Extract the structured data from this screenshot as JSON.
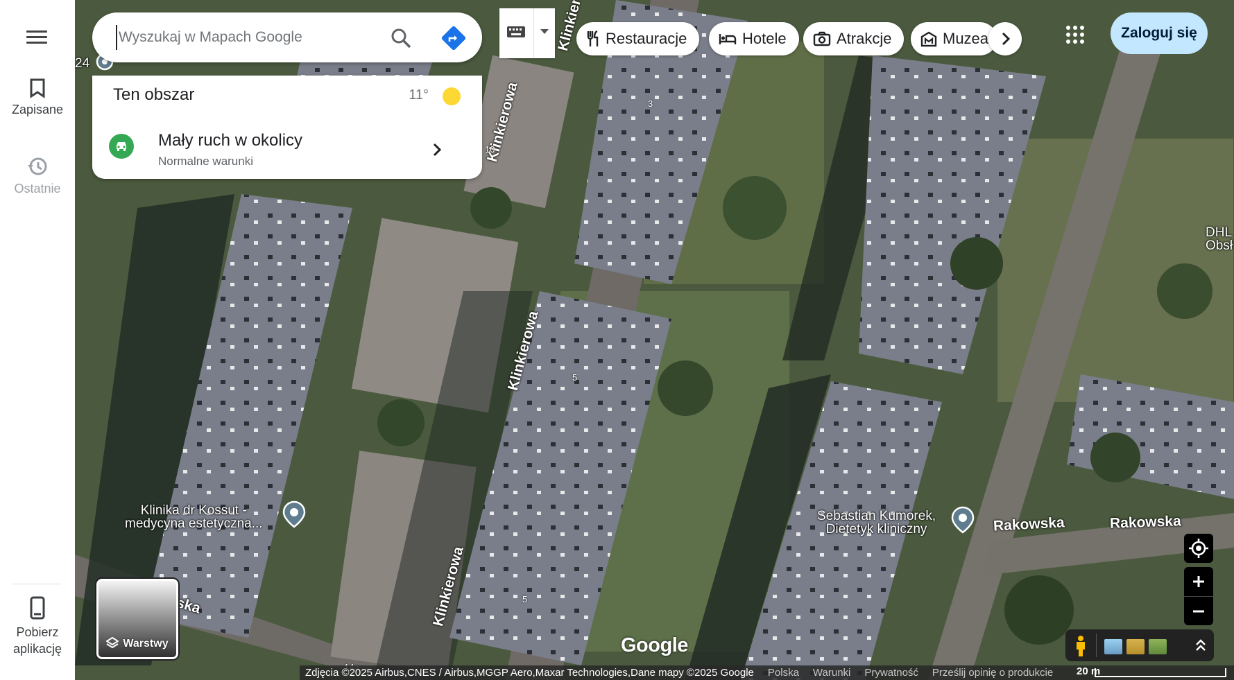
{
  "rail": {
    "menu_icon": "menu-icon",
    "saved_label": "Zapisane",
    "saved_icon": "bookmark-icon",
    "recent_label": "Ostatnie",
    "recent_icon": "history-icon",
    "get_app_label": "Pobierz aplikację",
    "get_app_icon": "phone-icon"
  },
  "search": {
    "placeholder": "Wyszukaj w Mapach Google",
    "search_icon": "search-icon",
    "directions_icon": "directions-icon"
  },
  "keyboard": {
    "icon": "keyboard-icon",
    "dropdown_icon": "caret-down-icon"
  },
  "chips": [
    {
      "label": "Restauracje",
      "icon": "restaurant-icon"
    },
    {
      "label": "Hotele",
      "icon": "hotel-icon"
    },
    {
      "label": "Atrakcje",
      "icon": "camera-icon"
    },
    {
      "label": "Muzea",
      "icon": "museum-icon"
    }
  ],
  "chips_next_icon": "chevron-right-icon",
  "apps_icon": "apps-grid-icon",
  "login_label": "Zaloguj się",
  "area_card": {
    "title": "Ten obszar",
    "temperature": "11°",
    "weather_icon": "sun-icon",
    "traffic_title": "Mały ruch w okolicy",
    "traffic_subtitle": "Normalne warunki",
    "traffic_icon": "car-traffic-icon"
  },
  "map": {
    "streets": [
      "Klinkierowa",
      "Klinkierowa",
      "Klinkierowa",
      "Klinkierowa",
      "Rakowska",
      "Rakowska",
      "wska"
    ],
    "pois": [
      {
        "line1": "Klinika dr Kossut -",
        "line2": "medycyna estetyczna..."
      },
      {
        "line1": "Sebastian Kumorek,",
        "line2": "Dietetyk kliniczny"
      }
    ],
    "edge_label_left": "24",
    "edge_label_right_1": "DHL",
    "edge_label_right_2": "Obsł",
    "house_numbers": [
      "3",
      "10",
      "5",
      "5",
      "14a"
    ],
    "logo": "Google"
  },
  "layers_label": "Warstwy",
  "controls": {
    "my_location_icon": "my-location-icon",
    "zoom_in_icon": "zoom-in-icon",
    "zoom_out_icon": "zoom-out-icon",
    "pegman_icon": "pegman-icon",
    "expand_icon": "expand-up-icon"
  },
  "footer": {
    "attribution": "Zdjęcia ©2025 Airbus,CNES / Airbus,MGGP Aero,Maxar Technologies,Dane mapy ©2025 Google",
    "links": [
      "Polska",
      "Warunki",
      "Prywatność",
      "Prześlij opinię o produkcie"
    ],
    "scale": "20 m"
  },
  "colors": {
    "accent_blue": "#1a73e8",
    "login_bg": "#c2e7ff",
    "traffic_green": "#34a853",
    "sun_yellow": "#fdd835"
  }
}
